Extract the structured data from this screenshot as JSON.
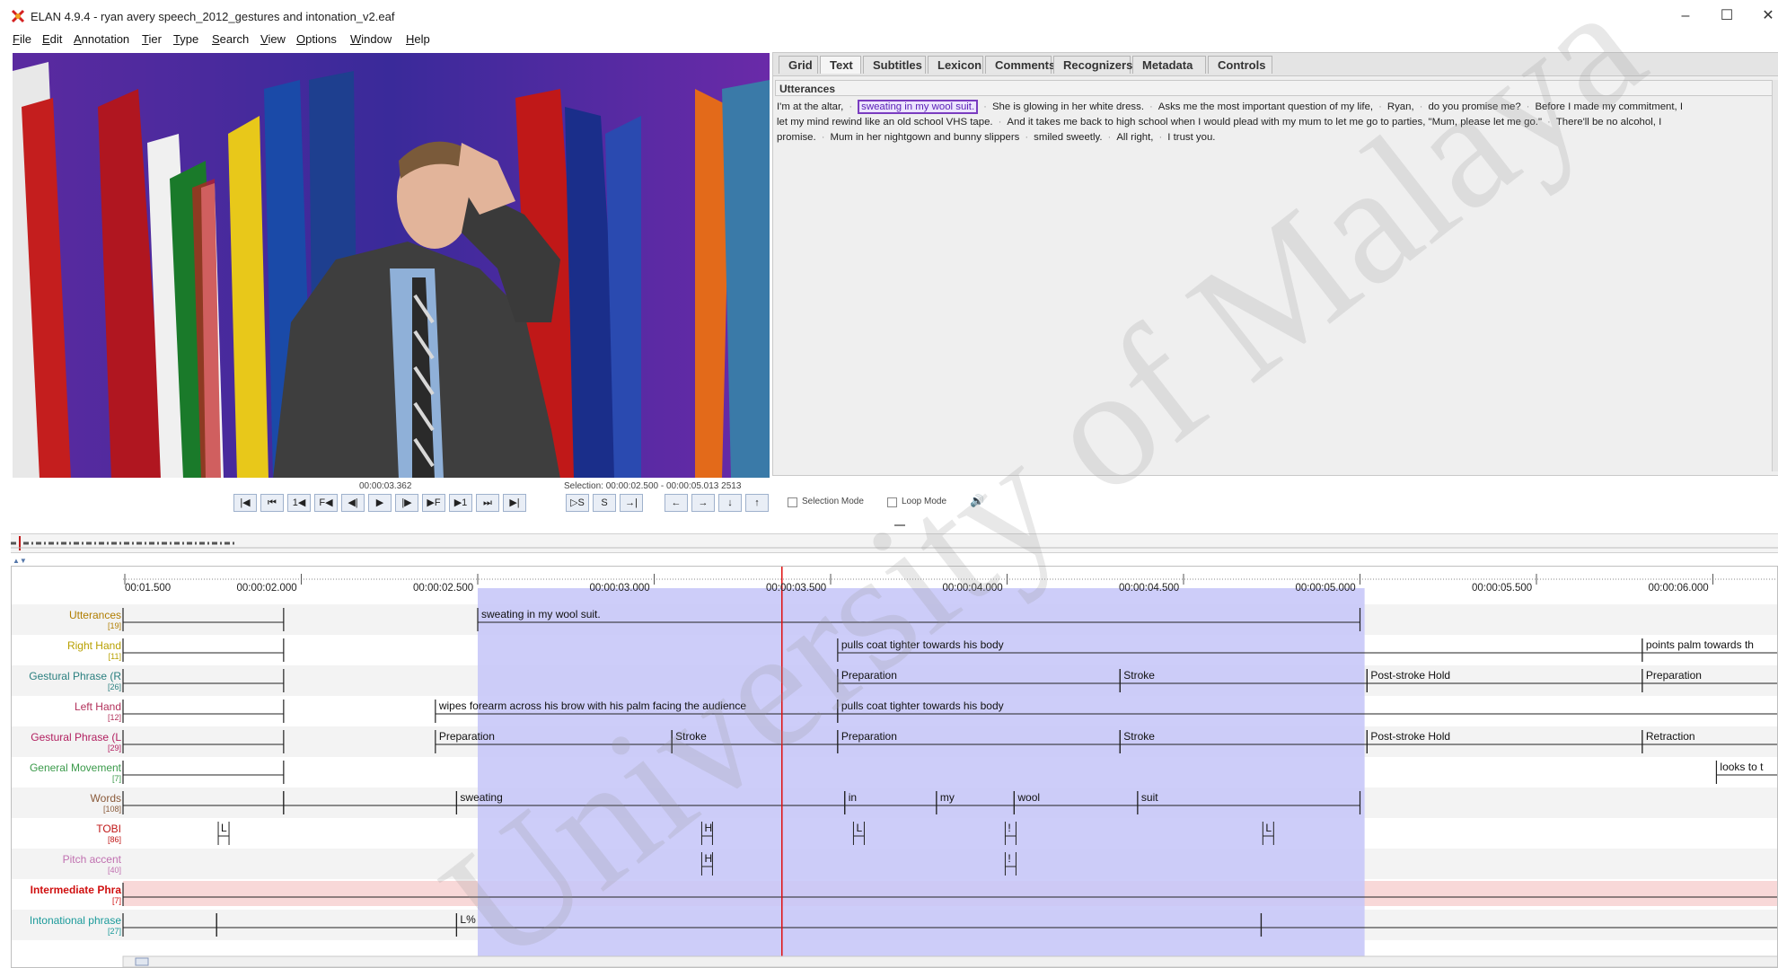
{
  "window": {
    "title": "ELAN 4.9.4 - ryan avery speech_2012_gestures and intonation_v2.eaf",
    "controls": [
      "–",
      "☐",
      "✕"
    ]
  },
  "menu": [
    {
      "mn": "F",
      "rest": "ile"
    },
    {
      "mn": "E",
      "rest": "dit"
    },
    {
      "mn": "A",
      "rest": "nnotation"
    },
    {
      "mn": "T",
      "rest": "ier"
    },
    {
      "mn": "T",
      "rest": "ype"
    },
    {
      "mn": "S",
      "rest": "earch"
    },
    {
      "mn": "V",
      "rest": "iew"
    },
    {
      "mn": "O",
      "rest": "ptions"
    },
    {
      "mn": "W",
      "rest": "indow"
    },
    {
      "mn": "H",
      "rest": "elp"
    }
  ],
  "tabs": [
    "Grid",
    "Text",
    "Subtitles",
    "Lexicon",
    "Comments",
    "Recognizers",
    "Metadata",
    "Controls"
  ],
  "active_tab": "Text",
  "text_view": {
    "tier": "Utterances",
    "lines": [
      [
        {
          "t": "I'm at the altar,"
        },
        {
          "t": "sweating in my wool suit.",
          "hl": true
        },
        {
          "t": "She is glowing in her white dress."
        },
        {
          "t": "Asks me the most important question of my life,"
        },
        {
          "t": "Ryan,"
        },
        {
          "t": "do you promise me?"
        },
        {
          "t": "Before I made my commitment, I"
        }
      ],
      [
        {
          "t": "let my mind rewind like an old school VHS tape."
        },
        {
          "t": "And it takes me back to high school when I would plead with my mum to let me go to parties, \"Mum, please let me go.\""
        },
        {
          "t": "There'll be no alcohol, I"
        }
      ],
      [
        {
          "t": "promise."
        },
        {
          "t": "Mum in her nightgown and bunny slippers"
        },
        {
          "t": "smiled sweetly."
        },
        {
          "t": "All right,"
        },
        {
          "t": "I trust you."
        }
      ]
    ]
  },
  "player": {
    "current_time": "00:00:03.362",
    "selection": "Selection: 00:00:02.500 - 00:00:05.013  2513",
    "buttons_left": [
      "|◀",
      "⏮",
      "1◀",
      "F◀",
      "◀|",
      "▶",
      "|▶",
      "▶F",
      "▶1",
      "⏭",
      "▶|"
    ],
    "buttons_sel": [
      "▷S",
      "S",
      "→|"
    ],
    "buttons_nav": [
      "←",
      "→",
      "↓",
      "↑"
    ],
    "selection_mode_label": "Selection Mode",
    "loop_mode_label": "Loop Mode",
    "volume_icon": "🔊"
  },
  "timeline": {
    "ticks": [
      {
        "label": "00:01.500",
        "t": 1.5
      },
      {
        "label": "00:00:02.000",
        "t": 2.0
      },
      {
        "label": "00:00:02.500",
        "t": 2.5
      },
      {
        "label": "00:00:03.000",
        "t": 3.0
      },
      {
        "label": "00:00:03.500",
        "t": 3.5
      },
      {
        "label": "00:00:04.000",
        "t": 4.0
      },
      {
        "label": "00:00:04.500",
        "t": 4.5
      },
      {
        "label": "00:00:05.000",
        "t": 5.0
      },
      {
        "label": "00:00:05.500",
        "t": 5.5
      },
      {
        "label": "00:00:06.000",
        "t": 6.0
      }
    ],
    "selection": {
      "start": 2.5,
      "end": 5.013
    },
    "cursor": 3.362,
    "tiers": [
      {
        "name": "Utterances",
        "count": "[19]",
        "color": "#b07d00",
        "annotations": [
          {
            "start": 1.0,
            "end": 1.95,
            "text": ""
          },
          {
            "start": 2.5,
            "end": 5.0,
            "text": "sweating in my wool suit."
          }
        ]
      },
      {
        "name": "Right Hand",
        "count": "[11]",
        "color": "#b8a000",
        "annotations": [
          {
            "start": 1.0,
            "end": 1.95,
            "text": ""
          },
          {
            "start": 3.52,
            "end": 5.8,
            "text": "pulls coat tighter towards his body"
          },
          {
            "start": 5.8,
            "end": 6.3,
            "text": "points palm towards th"
          }
        ]
      },
      {
        "name": "Gestural Phrase (R",
        "count": "[26]",
        "color": "#2a7f7f",
        "annotations": [
          {
            "start": 1.0,
            "end": 1.95,
            "text": ""
          },
          {
            "start": 3.52,
            "end": 4.32,
            "text": "Preparation"
          },
          {
            "start": 4.32,
            "end": 5.02,
            "text": "Stroke"
          },
          {
            "start": 5.02,
            "end": 5.8,
            "text": "Post-stroke Hold"
          },
          {
            "start": 5.8,
            "end": 6.3,
            "text": "Preparation"
          }
        ]
      },
      {
        "name": "Left Hand",
        "count": "[12]",
        "color": "#b2305a",
        "annotations": [
          {
            "start": 1.0,
            "end": 1.95,
            "text": ""
          },
          {
            "start": 2.38,
            "end": 3.52,
            "text": "wipes forearm across his brow with his palm facing the audience"
          },
          {
            "start": 3.52,
            "end": 6.3,
            "text": "pulls coat tighter towards his body"
          }
        ]
      },
      {
        "name": "Gestural Phrase (L",
        "count": "[29]",
        "color": "#b22060",
        "annotations": [
          {
            "start": 1.0,
            "end": 1.95,
            "text": ""
          },
          {
            "start": 2.38,
            "end": 3.05,
            "text": "Preparation"
          },
          {
            "start": 3.05,
            "end": 3.52,
            "text": "Stroke"
          },
          {
            "start": 3.52,
            "end": 4.32,
            "text": "Preparation"
          },
          {
            "start": 4.32,
            "end": 5.02,
            "text": "Stroke"
          },
          {
            "start": 5.02,
            "end": 5.8,
            "text": "Post-stroke Hold"
          },
          {
            "start": 5.8,
            "end": 6.3,
            "text": "Retraction"
          }
        ]
      },
      {
        "name": "General Movement",
        "count": "[7]",
        "color": "#3a9a4a",
        "annotations": [
          {
            "start": 1.0,
            "end": 1.95,
            "text": ""
          },
          {
            "start": 6.01,
            "end": 6.3,
            "text": "looks to t"
          }
        ]
      },
      {
        "name": "Words",
        "count": "[108]",
        "color": "#8a5a3a",
        "annotations": [
          {
            "start": 1.0,
            "end": 1.95,
            "text": ""
          },
          {
            "start": 1.95,
            "end": 2.44,
            "text": ""
          },
          {
            "start": 2.44,
            "end": 3.54,
            "text": "sweating"
          },
          {
            "start": 3.54,
            "end": 3.8,
            "text": "in"
          },
          {
            "start": 3.8,
            "end": 4.02,
            "text": "my"
          },
          {
            "start": 4.02,
            "end": 4.37,
            "text": "wool"
          },
          {
            "start": 4.37,
            "end": 5.0,
            "text": "suit"
          }
        ]
      },
      {
        "name": "TOBI",
        "count": "[86]",
        "color": "#c01818",
        "points": [
          {
            "t": 1.78,
            "text": "L"
          },
          {
            "t": 3.15,
            "text": "H"
          },
          {
            "t": 3.58,
            "text": "L"
          },
          {
            "t": 4.01,
            "text": "!"
          },
          {
            "t": 4.74,
            "text": "L"
          }
        ]
      },
      {
        "name": "Pitch accent",
        "count": "[40]",
        "color": "#c070b0",
        "points": [
          {
            "t": 3.15,
            "text": "H"
          },
          {
            "t": 4.01,
            "text": "!"
          }
        ]
      },
      {
        "name": "Intermediate Phra",
        "count": "[7]",
        "color": "#d01010",
        "bold": true,
        "annotations": [
          {
            "start": 1.0,
            "end": 6.3,
            "text": ""
          }
        ]
      },
      {
        "name": "Intonational phrase",
        "count": "[27]",
        "color": "#1a9a9a",
        "annotations": [
          {
            "start": 1.0,
            "end": 1.76,
            "text": ""
          },
          {
            "start": 1.76,
            "end": 2.44,
            "text": ""
          },
          {
            "start": 2.44,
            "end": 4.72,
            "text": "L%"
          },
          {
            "start": 4.72,
            "end": 6.3,
            "text": ""
          }
        ]
      }
    ]
  },
  "watermark": "University of Malaya",
  "colors": {
    "selection": "#c8c8f8",
    "cursor": "#e01010",
    "tab_active": "#f5f5f5",
    "highlight": "#7a3cc0"
  }
}
